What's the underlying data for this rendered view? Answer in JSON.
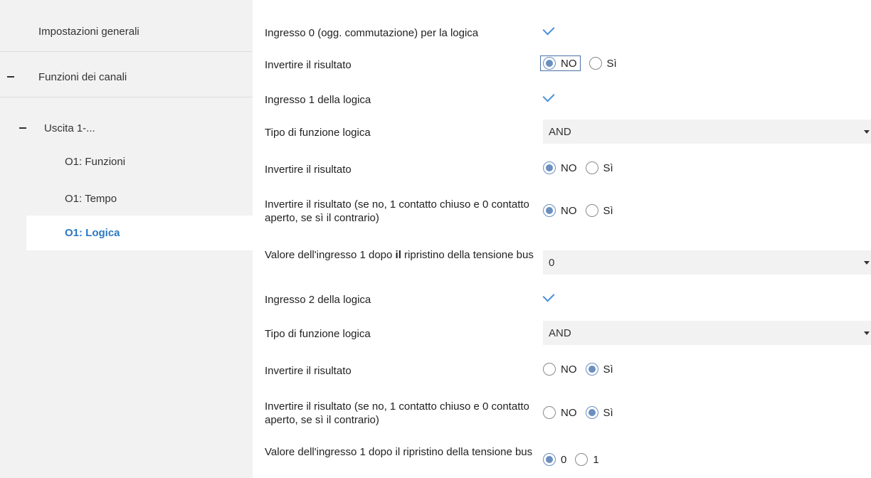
{
  "sidebar": {
    "general": "Impostazioni generali",
    "channel_functions": "Funzioni dei canali",
    "output": "Uscita 1-...",
    "o1_functions": "O1: Funzioni",
    "o1_time": "O1: Tempo",
    "o1_logic": "O1: Logica"
  },
  "rows": {
    "r0": {
      "label": "Ingresso 0 (ogg. commutazione) per la logica",
      "checked": true
    },
    "r1": {
      "label": "Invertire il risultato",
      "opt_a": "NO",
      "opt_b": "Sì",
      "selected": "NO"
    },
    "r2": {
      "label": "Ingresso 1 della logica",
      "checked": true
    },
    "r3": {
      "label": "Tipo di funzione logica",
      "value": "AND"
    },
    "r4": {
      "label": "Invertire il risultato",
      "opt_a": "NO",
      "opt_b": "Sì",
      "selected": "NO"
    },
    "r5": {
      "label": "Invertire il risultato (se no, 1 contatto chiuso e 0 contatto aperto, se sì il contrario)",
      "opt_a": "NO",
      "opt_b": "Sì",
      "selected": "NO"
    },
    "r6": {
      "label_pre": "Valore dell'ingresso 1 dopo ",
      "label_bold": "il",
      "label_post": " ripristino della tensione bus",
      "value": "0"
    },
    "r7": {
      "label": "Ingresso 2 della logica",
      "checked": true
    },
    "r8": {
      "label": "Tipo di funzione logica",
      "value": "AND"
    },
    "r9": {
      "label": "Invertire il risultato",
      "opt_a": "NO",
      "opt_b": "Sì",
      "selected": "Sì"
    },
    "r10": {
      "label": "Invertire il risultato (se no, 1 contatto chiuso e 0 contatto aperto, se sì il contrario)",
      "opt_a": "NO",
      "opt_b": "Sì",
      "selected": "Sì"
    },
    "r11": {
      "label": "Valore dell'ingresso 1 dopo il ripristino della tensione bus",
      "opt_a": "0",
      "opt_b": "1",
      "selected": "0"
    }
  },
  "colors": {
    "accent": "#2b78c2",
    "sidebar_bg": "#f2f2f2",
    "radio_fill": "#6b8fbf"
  }
}
